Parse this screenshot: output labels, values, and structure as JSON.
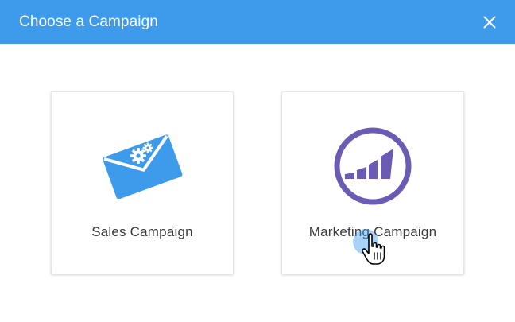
{
  "dialog": {
    "title": "Choose a Campaign",
    "close_icon": "close-icon"
  },
  "cards": [
    {
      "label": "Sales Campaign",
      "icon": "envelope-gears-icon",
      "color": "#3e9bec"
    },
    {
      "label": "Marketing Campaign",
      "icon": "marketo-logo-icon",
      "color": "#6c5bb5"
    }
  ],
  "colors": {
    "header_bg": "#3e9bec",
    "text": "#3a3a3a",
    "sales_accent": "#3e9bec",
    "marketing_accent": "#6c5bb5"
  },
  "cursor": {
    "icon": "hand-pointer-icon"
  }
}
